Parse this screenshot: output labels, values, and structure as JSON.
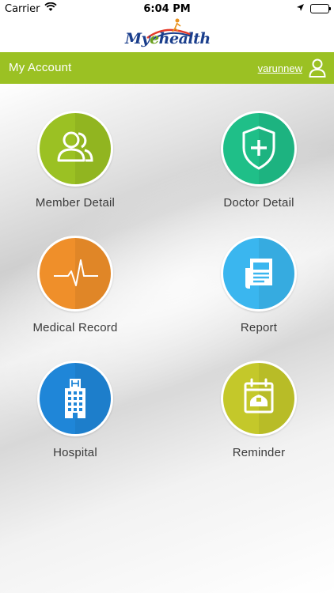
{
  "status_bar": {
    "carrier": "Carrier",
    "time": "6:04 PM"
  },
  "logo": {
    "my": "My",
    "e": "e",
    "health": "health"
  },
  "header": {
    "title": "My Account",
    "username": "varunnew"
  },
  "colors": {
    "header_green": "#9bc123",
    "member": "#9bc123",
    "doctor": "#1fbf88",
    "medical": "#ef8f2a",
    "report": "#3ab6ef",
    "hospital": "#1f86d8",
    "reminder": "#c4c82a"
  },
  "menu": [
    {
      "label": "Member Detail",
      "icon": "users-icon"
    },
    {
      "label": "Doctor Detail",
      "icon": "shield-plus-icon"
    },
    {
      "label": "Medical Record",
      "icon": "heartbeat-icon"
    },
    {
      "label": "Report",
      "icon": "newspaper-icon"
    },
    {
      "label": "Hospital",
      "icon": "hospital-building-icon"
    },
    {
      "label": "Reminder",
      "icon": "calendar-icon"
    }
  ]
}
